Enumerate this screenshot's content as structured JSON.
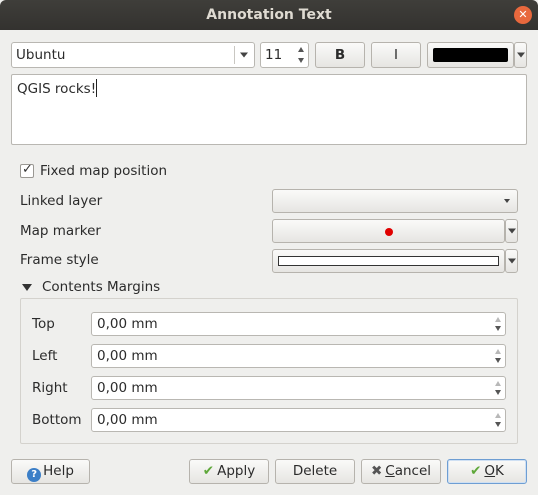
{
  "window": {
    "title": "Annotation Text"
  },
  "font_toolbar": {
    "font_family": "Ubuntu",
    "font_size": "11",
    "bold_label": "B",
    "italic_label": "I",
    "text_color": "#000000"
  },
  "editor": {
    "text": "QGIS rocks!"
  },
  "options": {
    "fixed_map_position_label": "Fixed map position",
    "fixed_map_position_checked": true,
    "linked_layer_label": "Linked layer",
    "linked_layer_value": "",
    "map_marker_label": "Map marker",
    "map_marker_color": "#e00000",
    "frame_style_label": "Frame style"
  },
  "margins": {
    "title": "Contents Margins",
    "rows": [
      {
        "label": "Top",
        "value": "0,00 mm"
      },
      {
        "label": "Left",
        "value": "0,00 mm"
      },
      {
        "label": "Right",
        "value": "0,00 mm"
      },
      {
        "label": "Bottom",
        "value": "0,00 mm"
      }
    ]
  },
  "buttons": {
    "help": "Help",
    "apply": "Apply",
    "delete": "Delete",
    "cancel_prefix": "",
    "cancel_mnemonic": "C",
    "cancel_rest": "ancel",
    "ok_mnemonic": "O",
    "ok_rest": "K"
  }
}
